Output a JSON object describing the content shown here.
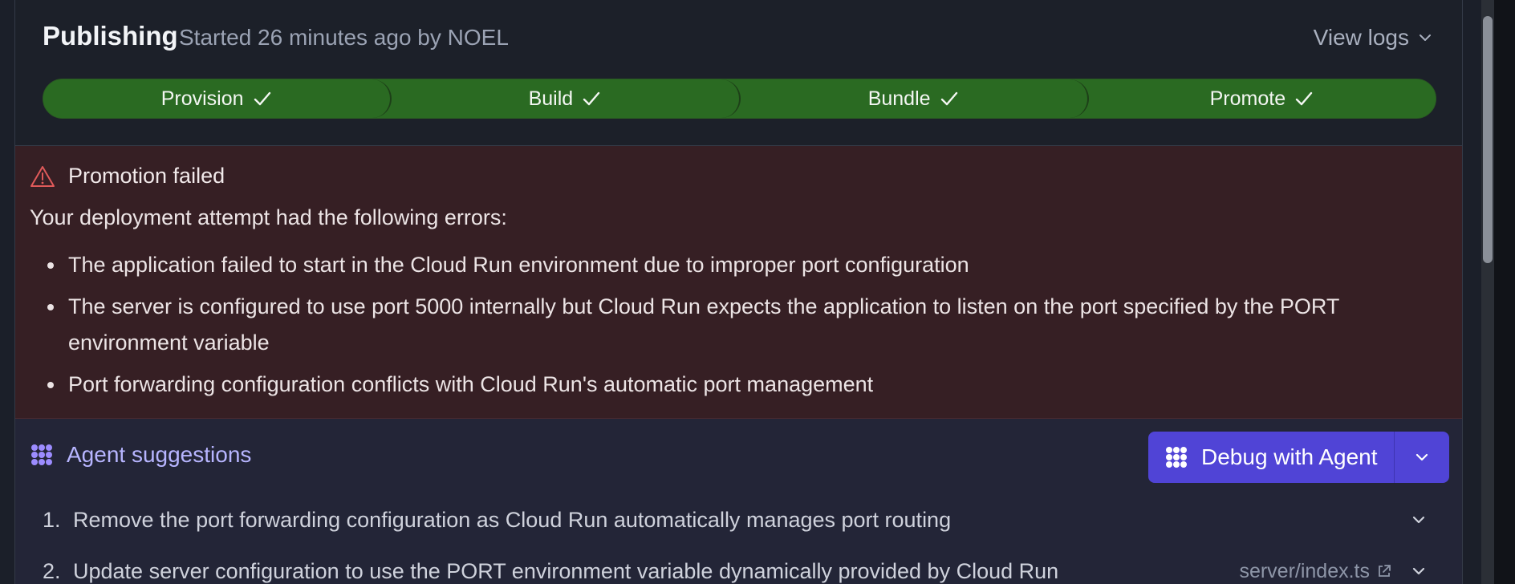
{
  "header": {
    "title": "Publishing",
    "subtitle": "Started 26 minutes ago by NOEL",
    "view_logs": "View logs"
  },
  "steps": [
    {
      "label": "Provision",
      "status": "done"
    },
    {
      "label": "Build",
      "status": "done"
    },
    {
      "label": "Bundle",
      "status": "done"
    },
    {
      "label": "Promote",
      "status": "done"
    }
  ],
  "error": {
    "title": "Promotion failed",
    "intro": "Your deployment attempt had the following errors:",
    "items": [
      "The application failed to start in the Cloud Run environment due to improper port configuration",
      "The server is configured to use port 5000 internally but Cloud Run expects the application to listen on the port specified by the PORT environment variable",
      "Port forwarding configuration conflicts with Cloud Run's automatic port management"
    ]
  },
  "agent": {
    "title": "Agent suggestions",
    "debug_label": "Debug with Agent",
    "suggestions": [
      {
        "num": "1.",
        "text": "Remove the port forwarding configuration as Cloud Run automatically manages port routing",
        "file": ""
      },
      {
        "num": "2.",
        "text": "Update server configuration to use the PORT environment variable dynamically provided by Cloud Run",
        "file": "server/index.ts"
      }
    ]
  },
  "colors": {
    "step_success": "#2a6a22",
    "error_bg": "#361f24",
    "agent_accent": "#5044d6"
  }
}
